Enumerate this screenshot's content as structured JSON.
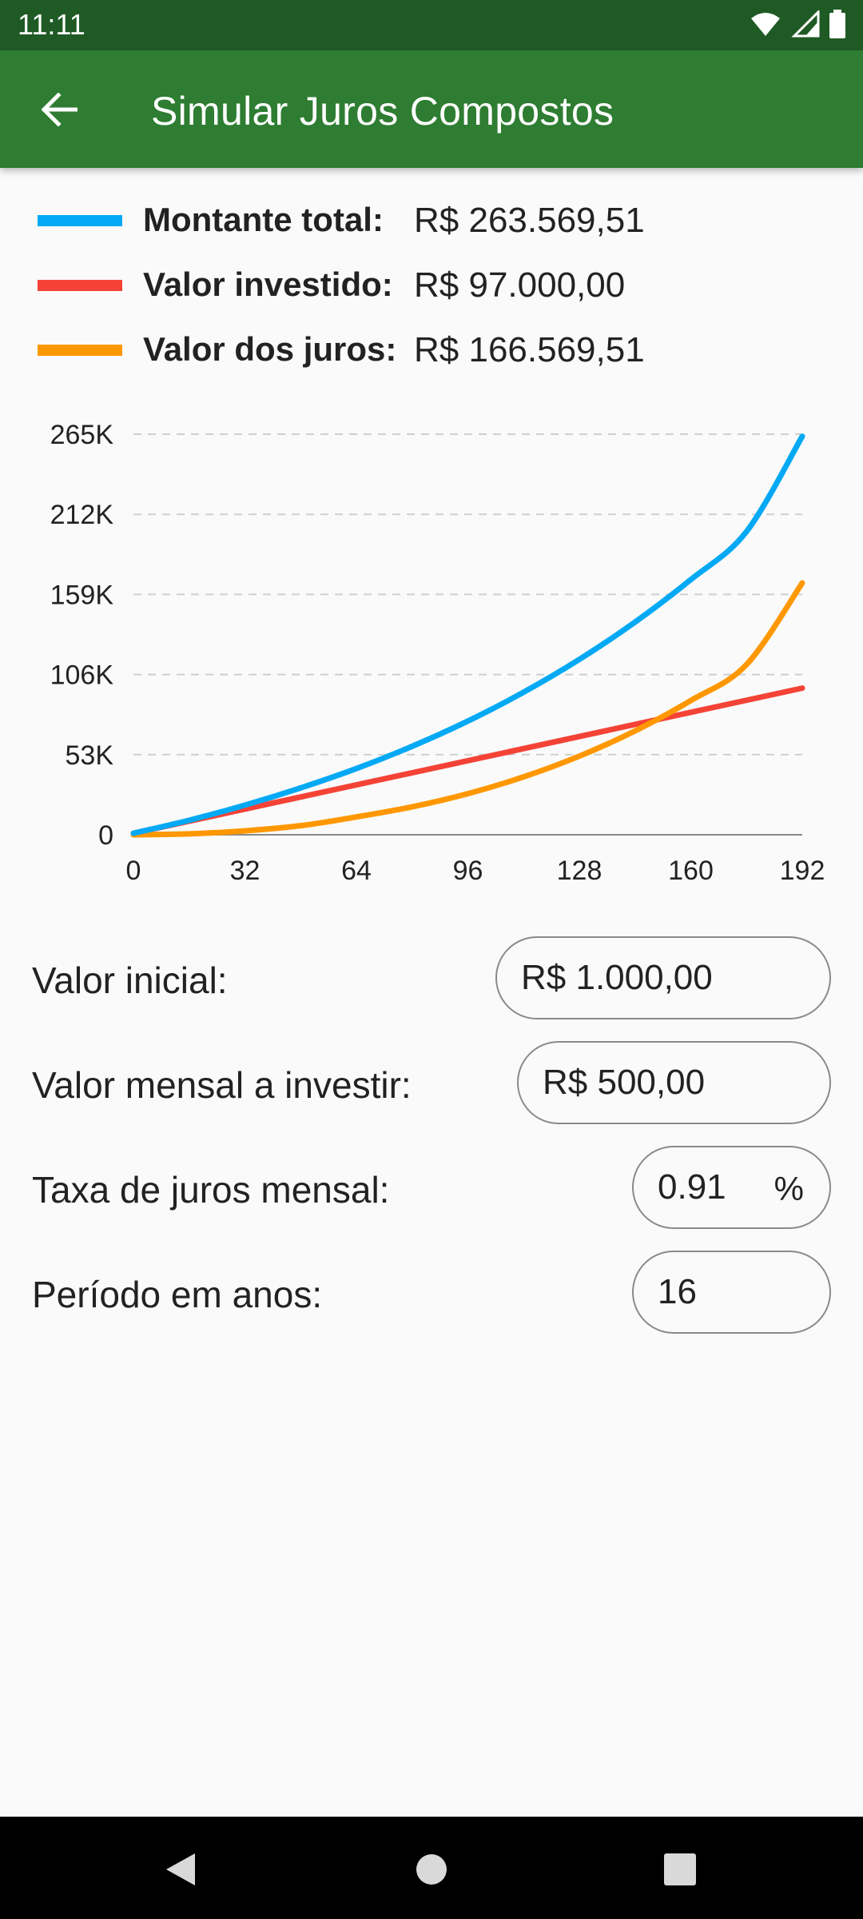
{
  "status_bar": {
    "time": "11:11",
    "icons": [
      "wifi-icon",
      "signal-icon",
      "battery-icon"
    ]
  },
  "app_bar": {
    "back_icon": "arrow-left-icon",
    "title": "Simular Juros Compostos"
  },
  "legend": [
    {
      "label": "Montante total:",
      "value": "R$ 263.569,51",
      "color": "#03a9f4"
    },
    {
      "label": "Valor investido:",
      "value": "R$ 97.000,00",
      "color": "#f44336"
    },
    {
      "label": "Valor dos juros:",
      "value": "R$ 166.569,51",
      "color": "#ff9800"
    }
  ],
  "chart_data": {
    "type": "line",
    "x_ticks": [
      "0",
      "32",
      "64",
      "96",
      "128",
      "160",
      "192"
    ],
    "y_ticks": [
      "0",
      "53K",
      "106K",
      "159K",
      "212K",
      "265K"
    ],
    "xlim": [
      0,
      192
    ],
    "ylim": [
      0,
      265000
    ],
    "grid": "horizontal-dashed",
    "series": [
      {
        "color": "#03a9f4",
        "x": [
          0,
          16,
          32,
          48,
          64,
          80,
          96,
          112,
          128,
          144,
          160,
          176,
          192
        ],
        "y": [
          1000,
          9600,
          19600,
          31000,
          43800,
          58500,
          75200,
          94300,
          116000,
          140700,
          168800,
          200600,
          263569.51
        ]
      },
      {
        "color": "#f44336",
        "x": [
          0,
          192
        ],
        "y": [
          1000,
          97000
        ]
      },
      {
        "color": "#ff9800",
        "x": [
          0,
          16,
          32,
          48,
          64,
          80,
          96,
          112,
          128,
          144,
          160,
          176,
          192
        ],
        "y": [
          0,
          600,
          2600,
          6000,
          11800,
          18500,
          27200,
          38300,
          52000,
          68700,
          88800,
          112600,
          166569.51
        ]
      }
    ]
  },
  "form": {
    "initial_label": "Valor inicial:",
    "initial_value": "R$ 1.000,00",
    "monthly_label": "Valor mensal a investir:",
    "monthly_value": "R$ 500,00",
    "rate_label": "Taxa de juros mensal:",
    "rate_value": "0.91",
    "rate_suffix": "%",
    "period_label": "Período em anos:",
    "period_value": "16"
  },
  "nav_bar": {
    "icons": [
      "back-triangle-icon",
      "home-circle-icon",
      "recents-square-icon"
    ]
  }
}
